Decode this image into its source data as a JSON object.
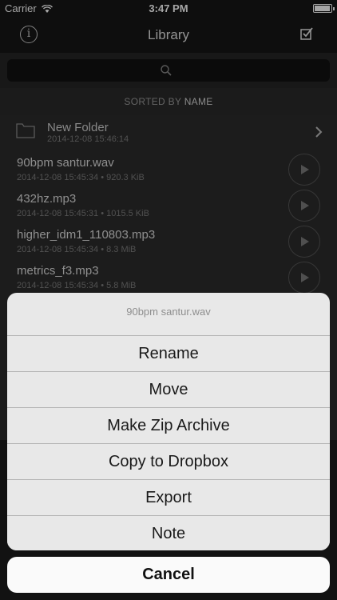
{
  "status_bar": {
    "carrier": "Carrier",
    "time": "3:47 PM"
  },
  "nav": {
    "title": "Library",
    "left_icon": "info-icon",
    "right_icon": "checkbox-icon"
  },
  "search": {
    "placeholder": ""
  },
  "sort": {
    "prefix": "SORTED BY",
    "key": "NAME"
  },
  "folder": {
    "name": "New Folder",
    "date": "2014-12-08 15:46:14"
  },
  "files": [
    {
      "name": "90bpm santur.wav",
      "meta": "2014-12-08 15:45:34 • 920.3 KiB"
    },
    {
      "name": "432hz.mp3",
      "meta": "2014-12-08 15:45:31 • 1015.5 KiB"
    },
    {
      "name": "higher_idm1_110803.mp3",
      "meta": "2014-12-08 15:45:34 • 8.3 MiB"
    },
    {
      "name": "metrics_f3.mp3",
      "meta": "2014-12-08 15:45:34 • 5.8 MiB"
    }
  ],
  "action_sheet": {
    "title": "90bpm santur.wav",
    "buttons": [
      "Rename",
      "Move",
      "Make Zip Archive",
      "Copy to Dropbox",
      "Export",
      "Note"
    ],
    "cancel": "Cancel"
  }
}
